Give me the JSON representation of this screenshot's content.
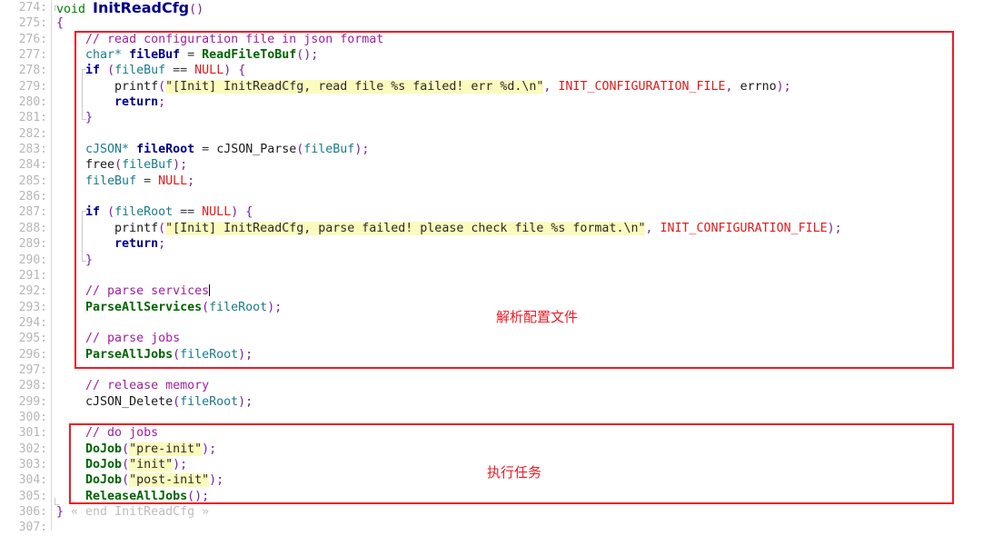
{
  "editor": {
    "kind": "source-code-viewer",
    "language": "C",
    "first_line_number": 274,
    "last_line_number": 307,
    "colors": {
      "background": "#ffffff",
      "gutter_text": "#b7b7b7",
      "keyword": "#00008b",
      "type": "#008000",
      "function": "#006400",
      "comment": "#a020a0",
      "macro": "#e01b1b",
      "string_highlight": "#fbfbbe",
      "punctuation": "#7a1fa2",
      "identifier": "#1a7b8c",
      "annotation_red": "#ee1c25",
      "fold_guide": "#c9c9c9"
    }
  },
  "gutter": {
    "line_numbers": [
      "274:",
      "275:",
      "276:",
      "277:",
      "278:",
      "279:",
      "280:",
      "281:",
      "282:",
      "283:",
      "284:",
      "285:",
      "286:",
      "287:",
      "288:",
      "289:",
      "290:",
      "291:",
      "292:",
      "293:",
      "294:",
      "295:",
      "296:",
      "297:",
      "298:",
      "299:",
      "300:",
      "301:",
      "302:",
      "303:",
      "304:",
      "305:",
      "306:",
      "307:"
    ]
  },
  "code": {
    "lines": [
      {
        "n": 274,
        "text": "void InitReadCfg()"
      },
      {
        "n": 275,
        "text": "{"
      },
      {
        "n": 276,
        "text": "    // read configuration file in json format"
      },
      {
        "n": 277,
        "text": "    char* fileBuf = ReadFileToBuf();"
      },
      {
        "n": 278,
        "text": "    if (fileBuf == NULL) {"
      },
      {
        "n": 279,
        "text": "        printf(\"[Init] InitReadCfg, read file %s failed! err %d.\\n\", INIT_CONFIGURATION_FILE, errno);"
      },
      {
        "n": 280,
        "text": "        return;"
      },
      {
        "n": 281,
        "text": "    }"
      },
      {
        "n": 282,
        "text": ""
      },
      {
        "n": 283,
        "text": "    cJSON* fileRoot = cJSON_Parse(fileBuf);"
      },
      {
        "n": 284,
        "text": "    free(fileBuf);"
      },
      {
        "n": 285,
        "text": "    fileBuf = NULL;"
      },
      {
        "n": 286,
        "text": ""
      },
      {
        "n": 287,
        "text": "    if (fileRoot == NULL) {"
      },
      {
        "n": 288,
        "text": "        printf(\"[Init] InitReadCfg, parse failed! please check file %s format.\\n\", INIT_CONFIGURATION_FILE);"
      },
      {
        "n": 289,
        "text": "        return;"
      },
      {
        "n": 290,
        "text": "    }"
      },
      {
        "n": 291,
        "text": ""
      },
      {
        "n": 292,
        "text": "    // parse services"
      },
      {
        "n": 293,
        "text": "    ParseAllServices(fileRoot);"
      },
      {
        "n": 294,
        "text": ""
      },
      {
        "n": 295,
        "text": "    // parse jobs"
      },
      {
        "n": 296,
        "text": "    ParseAllJobs(fileRoot);"
      },
      {
        "n": 297,
        "text": ""
      },
      {
        "n": 298,
        "text": "    // release memory"
      },
      {
        "n": 299,
        "text": "    cJSON_Delete(fileRoot);"
      },
      {
        "n": 300,
        "text": ""
      },
      {
        "n": 301,
        "text": "    // do jobs"
      },
      {
        "n": 302,
        "text": "    DoJob(\"pre-init\");"
      },
      {
        "n": 303,
        "text": "    DoJob(\"init\");"
      },
      {
        "n": 304,
        "text": "    DoJob(\"post-init\");"
      },
      {
        "n": 305,
        "text": "    ReleaseAllJobs();"
      },
      {
        "n": 306,
        "text": "} « end InitReadCfg »"
      },
      {
        "n": 307,
        "text": ""
      }
    ],
    "tokens": {
      "line274": {
        "type": "void",
        "name": "InitReadCfg",
        "parens": "()"
      },
      "line275": {
        "brace": "{"
      },
      "line276": {
        "comment": "// read configuration file in json format"
      },
      "line277": {
        "type": "char*",
        "var": "fileBuf",
        "op": "=",
        "call": "ReadFileToBuf",
        "parens": "();"
      },
      "line278": {
        "kw": "if",
        "lparen": "(",
        "ident": "fileBuf",
        "op": "==",
        "null": "NULL",
        "rparen": ")",
        "brace": "{"
      },
      "line279": {
        "call": "printf",
        "lparen": "(",
        "string": "\"[Init] InitReadCfg, read file %s failed! err %d.\\n\"",
        "comma1": ",",
        "macro": "INIT_CONFIGURATION_FILE",
        "comma2": ",",
        "arg2": "errno",
        "tail": ");"
      },
      "line280": {
        "kw": "return",
        "semi": ";"
      },
      "line281": {
        "brace": "}"
      },
      "line283": {
        "type": "cJSON*",
        "var": "fileRoot",
        "op": "=",
        "call": "cJSON_Parse",
        "lparen": "(",
        "arg": "fileBuf",
        "tail": ");"
      },
      "line284": {
        "call": "free",
        "lparen": "(",
        "arg": "fileBuf",
        "tail": ");"
      },
      "line285": {
        "ident": "fileBuf",
        "op": "=",
        "null": "NULL",
        "semi": ";"
      },
      "line287": {
        "kw": "if",
        "lparen": "(",
        "ident": "fileRoot",
        "op": "==",
        "null": "NULL",
        "rparen": ")",
        "brace": "{"
      },
      "line288": {
        "call": "printf",
        "lparen": "(",
        "string": "\"[Init] InitReadCfg, parse failed! please check file %s format.\\n\"",
        "comma": ",",
        "macro": "INIT_CONFIGURATION_FILE",
        "tail": ");"
      },
      "line289": {
        "kw": "return",
        "semi": ";"
      },
      "line290": {
        "brace": "}"
      },
      "line292": {
        "comment": "// parse services",
        "caret": true
      },
      "line293": {
        "func": "ParseAllServices",
        "lparen": "(",
        "arg": "fileRoot",
        "tail": ");"
      },
      "line295": {
        "comment": "// parse jobs"
      },
      "line296": {
        "func": "ParseAllJobs",
        "lparen": "(",
        "arg": "fileRoot",
        "tail": ");"
      },
      "line298": {
        "comment": "// release memory"
      },
      "line299": {
        "call": "cJSON_Delete",
        "lparen": "(",
        "arg": "fileRoot",
        "tail": ");"
      },
      "line301": {
        "comment": "// do jobs"
      },
      "line302": {
        "func": "DoJob",
        "lparen": "(",
        "string": "\"pre-init\"",
        "tail": ");"
      },
      "line303": {
        "func": "DoJob",
        "lparen": "(",
        "string": "\"init\"",
        "tail": ");"
      },
      "line304": {
        "func": "DoJob",
        "lparen": "(",
        "string": "\"post-init\"",
        "tail": ");"
      },
      "line305": {
        "func": "ReleaseAllJobs",
        "tail": "();"
      },
      "line306": {
        "brace": "}",
        "fold": "« end InitReadCfg »"
      }
    }
  },
  "annotations": {
    "box1": {
      "label": "解析配置文件",
      "covers_lines": "276-296"
    },
    "box2": {
      "label": "执行任务",
      "covers_lines": "301-306"
    }
  }
}
